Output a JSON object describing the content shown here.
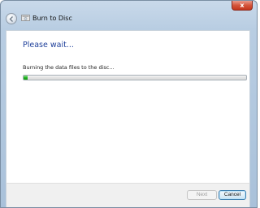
{
  "window": {
    "title": "Burn to Disc",
    "close_label": "x"
  },
  "content": {
    "heading": "Please wait...",
    "status": "Burning the data files to the disc...",
    "progress_fraction": 0.02
  },
  "buttons": {
    "next": "Next",
    "cancel": "Cancel"
  },
  "icons": {
    "back": "back-arrow-icon",
    "title": "burn-disc-icon"
  },
  "colors": {
    "heading": "#1e3f9a",
    "progress": "#22b422",
    "close": "#c4351c"
  }
}
